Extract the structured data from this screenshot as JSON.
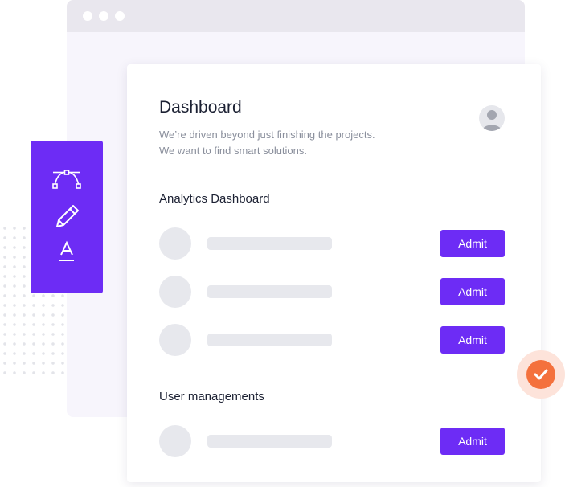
{
  "dashboard": {
    "title": "Dashboard",
    "subtitle_line1": "We’re driven beyond just finishing the projects.",
    "subtitle_line2": "We want to find smart solutions."
  },
  "sections": {
    "analytics_heading": "Analytics Dashboard",
    "users_heading": "User managements"
  },
  "rows": {
    "admit_label": "Admit"
  },
  "toolbar": {
    "icons": [
      "bezier-curve-icon",
      "pencil-icon",
      "text-color-icon"
    ]
  },
  "colors": {
    "accent": "#6d2cf5",
    "check": "#f4713d",
    "check_halo": "#fde3da",
    "placeholder": "#e7e8ed"
  }
}
